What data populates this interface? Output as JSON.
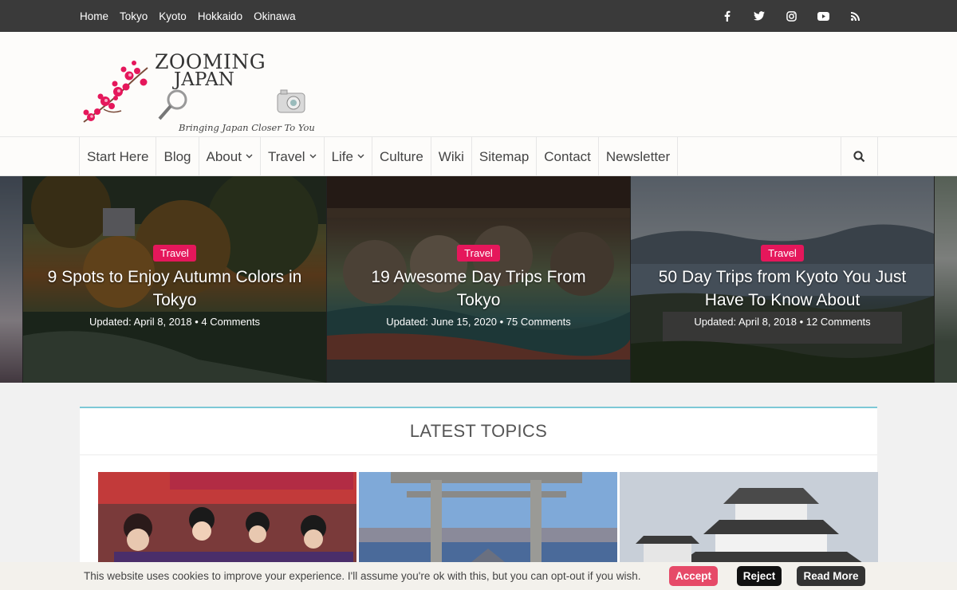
{
  "topbar": {
    "links": [
      "Home",
      "Tokyo",
      "Kyoto",
      "Hokkaido",
      "Okinawa"
    ],
    "social": [
      "facebook-icon",
      "twitter-icon",
      "instagram-icon",
      "youtube-icon",
      "rss-icon"
    ]
  },
  "logo": {
    "line1": "ZOOMING",
    "line2": "JAPAN",
    "tagline": "Bringing Japan Closer To You"
  },
  "nav": {
    "items": [
      {
        "label": "Start Here",
        "dropdown": false
      },
      {
        "label": "Blog",
        "dropdown": false
      },
      {
        "label": "About",
        "dropdown": true
      },
      {
        "label": "Travel",
        "dropdown": true
      },
      {
        "label": "Life",
        "dropdown": true
      },
      {
        "label": "Culture",
        "dropdown": false
      },
      {
        "label": "Wiki",
        "dropdown": false
      },
      {
        "label": "Sitemap",
        "dropdown": false
      },
      {
        "label": "Contact",
        "dropdown": false
      },
      {
        "label": "Newsletter",
        "dropdown": false
      }
    ]
  },
  "slides": [
    {
      "category": "Travel",
      "title": "9 Spots to Enjoy Autumn Colors in Tokyo",
      "meta": "Updated: April 8, 2018 • 4 Comments"
    },
    {
      "category": "Travel",
      "title": "19 Awesome Day Trips From Tokyo",
      "meta": "Updated: June 15, 2020 • 75 Comments"
    },
    {
      "category": "Travel",
      "title": "50 Day Trips from Kyoto You Just Have To Know About",
      "meta": "Updated: April 8, 2018 • 12 Comments"
    }
  ],
  "latest": {
    "heading": "LATEST TOPICS"
  },
  "cookie": {
    "text": "This website uses cookies to improve your experience. I'll assume you're ok with this, but you can opt-out if you wish.",
    "accept": "Accept",
    "reject": "Reject",
    "read_more": "Read More"
  },
  "colors": {
    "accent": "#e5175b",
    "topbar": "#3a3a3a",
    "latest_border": "#7dc8d6"
  }
}
